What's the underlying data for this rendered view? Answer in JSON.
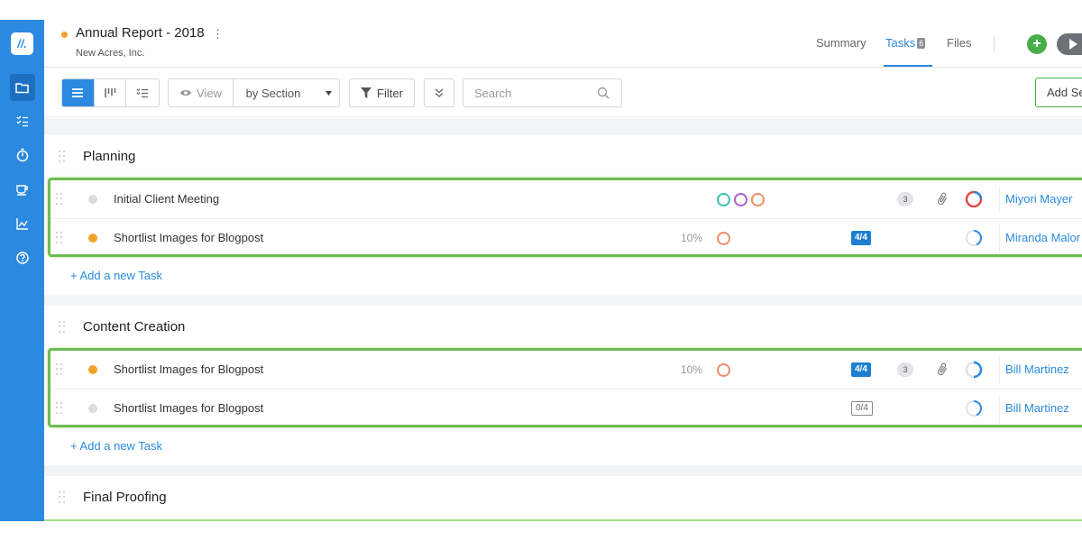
{
  "colors": {
    "brand": "#2b8ae0",
    "accent_green": "#49ad4b",
    "selection_border": "#6cbc55",
    "status_orange": "#f0a22a",
    "status_grey": "#dadcdf"
  },
  "sidebar": {
    "logo_icon": "workflow-logo",
    "items": [
      {
        "icon": "folder-icon",
        "active": true
      },
      {
        "icon": "task-list-icon",
        "active": false
      },
      {
        "icon": "stopwatch-icon",
        "active": false
      },
      {
        "icon": "coffee-cup-icon",
        "active": false
      },
      {
        "icon": "chart-icon",
        "active": false
      },
      {
        "icon": "help-icon",
        "active": false
      }
    ]
  },
  "header": {
    "title": "Annual Report - 2018",
    "menu_glyph": "⋮",
    "subtitle": "New Acres, Inc.",
    "tabs": [
      {
        "label": "Summary",
        "active": false
      },
      {
        "label": "Tasks",
        "badge": "6",
        "active": true
      },
      {
        "label": "Files",
        "active": false
      }
    ],
    "add_glyph": "+"
  },
  "toolbar": {
    "view_label": "View",
    "group_select": "by Section",
    "filter_label": "Filter",
    "search_placeholder": "Search",
    "add_section_label": "Add Se"
  },
  "sections": [
    {
      "title": "Planning",
      "add_task_label": "+ Add a new Task",
      "tasks": [
        {
          "name": "Initial Client Meeting",
          "status": "grey",
          "percent": "",
          "checklist": "",
          "comments": "3",
          "attachment": true,
          "progress": 0.75,
          "assignee": "Miyori Mayer"
        },
        {
          "name": "Shortlist Images for Blogpost",
          "status": "orange",
          "percent": "10%",
          "checklist": "4/4",
          "comments": "",
          "attachment": false,
          "progress": 0.8,
          "assignee": "Miranda Malor"
        }
      ]
    },
    {
      "title": "Content Creation",
      "add_task_label": "+ Add a new Task",
      "tasks": [
        {
          "name": "Shortlist Images for Blogpost",
          "status": "orange",
          "percent": "10%",
          "checklist": "4/4",
          "comments": "3",
          "attachment": true,
          "progress": 0.75,
          "assignee": "Bill Martinez"
        },
        {
          "name": "Shortlist Images for Blogpost",
          "status": "grey",
          "percent": "",
          "checklist": "0/4",
          "comments": "",
          "attachment": false,
          "progress": 0.8,
          "assignee": "Bill Martinez"
        }
      ]
    },
    {
      "title": "Final Proofing",
      "add_task_label": "",
      "tasks": []
    }
  ]
}
